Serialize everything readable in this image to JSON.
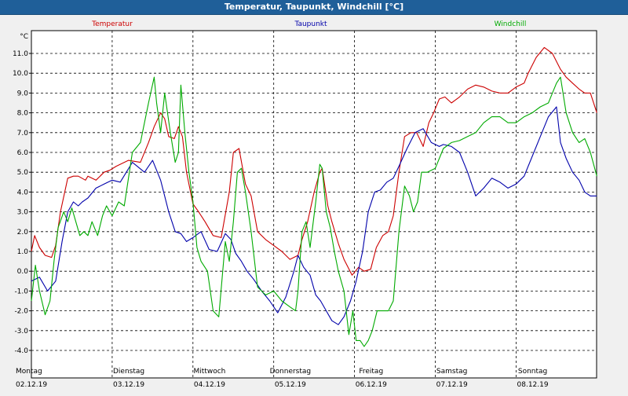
{
  "window": {
    "title": "Temperatur, Taupunkt, Windchill [°C]"
  },
  "chart_data": {
    "type": "line",
    "title": "Temperatur, Taupunkt, Windchill [°C]",
    "ylabel": "°C",
    "xlabel": "",
    "ylim": [
      -4.5,
      12.2
    ],
    "xlim": [
      0,
      7
    ],
    "y_ticks": [
      "11.0",
      "10.0",
      "9.0",
      "8.0",
      "7.0",
      "6.0",
      "5.0",
      "4.0",
      "3.0",
      "2.0",
      "1.0",
      "0.0",
      "-1.0",
      "-2.0",
      "-3.0",
      "-4.0"
    ],
    "y_tick_values": [
      11,
      10,
      9,
      8,
      7,
      6,
      5,
      4,
      3,
      2,
      1,
      0,
      -1,
      -2,
      -3,
      -4
    ],
    "x_tick_days": [
      {
        "day": "Montag",
        "date": "02.12.19"
      },
      {
        "day": "Dienstag",
        "date": "03.12.19"
      },
      {
        "day": "Mittwoch",
        "date": "04.12.19"
      },
      {
        "day": "Donnerstag",
        "date": "05.12.19"
      },
      {
        "day": "Freitag",
        "date": "06.12.19"
      },
      {
        "day": "Samstag",
        "date": "07.12.19"
      },
      {
        "day": "Sonntag",
        "date": "08.12.19"
      }
    ],
    "grid": true,
    "legend_placement": "top",
    "series": [
      {
        "name": "Temperatur",
        "color": "#cc0000",
        "x": [
          0.0,
          0.04,
          0.1,
          0.17,
          0.25,
          0.3,
          0.36,
          0.45,
          0.52,
          0.58,
          0.67,
          0.7,
          0.8,
          0.9,
          0.97,
          1.05,
          1.2,
          1.35,
          1.45,
          1.52,
          1.6,
          1.65,
          1.7,
          1.77,
          1.82,
          1.87,
          1.92,
          2.0,
          2.07,
          2.15,
          2.25,
          2.35,
          2.45,
          2.5,
          2.57,
          2.65,
          2.72,
          2.8,
          2.9,
          3.0,
          3.1,
          3.2,
          3.3,
          3.35,
          3.42,
          3.5,
          3.57,
          3.6,
          3.67,
          3.72,
          3.8,
          3.87,
          3.92,
          3.97,
          4.05,
          4.12,
          4.2,
          4.27,
          4.35,
          4.42,
          4.48,
          4.55,
          4.62,
          4.7,
          4.77,
          4.85,
          4.92,
          4.98,
          5.05,
          5.12,
          5.2,
          5.3,
          5.4,
          5.5,
          5.6,
          5.7,
          5.8,
          5.9,
          6.0,
          6.1,
          6.15,
          6.25,
          6.35,
          6.45,
          6.55,
          6.62,
          6.7,
          6.78,
          6.85,
          6.92,
          7.0
        ],
        "values": [
          1.0,
          1.8,
          1.2,
          0.8,
          0.7,
          1.3,
          3.0,
          4.7,
          4.8,
          4.8,
          4.6,
          4.8,
          4.6,
          5.0,
          5.1,
          5.3,
          5.6,
          5.5,
          6.5,
          7.3,
          8.0,
          7.7,
          6.8,
          6.7,
          7.3,
          6.8,
          5.0,
          3.4,
          3.0,
          2.5,
          1.8,
          1.7,
          4.0,
          6.0,
          6.2,
          4.4,
          3.8,
          2.0,
          1.6,
          1.3,
          1.0,
          0.6,
          0.8,
          1.6,
          2.5,
          4.0,
          5.0,
          5.2,
          3.3,
          2.5,
          1.4,
          0.6,
          0.2,
          -0.2,
          0.2,
          0.0,
          0.1,
          1.2,
          1.8,
          2.0,
          2.8,
          5.0,
          6.8,
          7.0,
          7.0,
          6.3,
          7.5,
          8.0,
          8.7,
          8.8,
          8.5,
          8.8,
          9.2,
          9.4,
          9.3,
          9.1,
          9.0,
          9.0,
          9.3,
          9.5,
          10.0,
          10.8,
          11.3,
          11.0,
          10.2,
          9.8,
          9.5,
          9.2,
          9.0,
          9.0,
          8.0
        ]
      },
      {
        "name": "Taupunkt",
        "color": "#0000aa",
        "x": [
          0.0,
          0.1,
          0.2,
          0.3,
          0.38,
          0.45,
          0.52,
          0.58,
          0.63,
          0.7,
          0.8,
          0.9,
          1.0,
          1.1,
          1.25,
          1.4,
          1.5,
          1.6,
          1.7,
          1.78,
          1.85,
          1.92,
          2.0,
          2.1,
          2.2,
          2.3,
          2.4,
          2.47,
          2.53,
          2.6,
          2.67,
          2.75,
          2.85,
          2.95,
          3.05,
          3.15,
          3.25,
          3.3,
          3.37,
          3.45,
          3.52,
          3.58,
          3.65,
          3.72,
          3.8,
          3.87,
          3.95,
          4.02,
          4.1,
          4.17,
          4.25,
          4.32,
          4.4,
          4.48,
          4.55,
          4.65,
          4.75,
          4.85,
          4.95,
          5.05,
          5.1,
          5.2,
          5.3,
          5.4,
          5.5,
          5.6,
          5.7,
          5.8,
          5.9,
          6.0,
          6.1,
          6.2,
          6.3,
          6.4,
          6.5,
          6.55,
          6.62,
          6.7,
          6.78,
          6.85,
          6.92,
          7.0
        ],
        "values": [
          -0.5,
          -0.3,
          -1.0,
          -0.5,
          1.5,
          3.0,
          3.5,
          3.3,
          3.5,
          3.7,
          4.2,
          4.4,
          4.6,
          4.5,
          5.5,
          5.0,
          5.6,
          4.6,
          3.0,
          2.0,
          1.9,
          1.5,
          1.7,
          2.0,
          1.1,
          1.0,
          1.9,
          1.6,
          0.9,
          0.5,
          0.0,
          -0.4,
          -1.0,
          -1.5,
          -2.1,
          -1.3,
          0.0,
          0.8,
          0.2,
          -0.2,
          -1.2,
          -1.5,
          -2.0,
          -2.5,
          -2.7,
          -2.3,
          -1.5,
          -0.5,
          1.0,
          3.0,
          4.0,
          4.1,
          4.5,
          4.7,
          5.3,
          6.2,
          7.0,
          7.2,
          6.5,
          6.3,
          6.4,
          6.3,
          6.0,
          5.0,
          3.8,
          4.2,
          4.7,
          4.5,
          4.2,
          4.4,
          4.8,
          5.8,
          6.8,
          7.8,
          8.3,
          6.5,
          5.7,
          5.0,
          4.6,
          4.0,
          3.8,
          3.8
        ]
      },
      {
        "name": "Windchill",
        "color": "#00aa00",
        "x": [
          0.0,
          0.05,
          0.1,
          0.17,
          0.23,
          0.28,
          0.33,
          0.4,
          0.45,
          0.5,
          0.55,
          0.6,
          0.65,
          0.7,
          0.75,
          0.82,
          0.88,
          0.93,
          1.0,
          1.08,
          1.15,
          1.25,
          1.35,
          1.45,
          1.52,
          1.55,
          1.6,
          1.65,
          1.72,
          1.78,
          1.82,
          1.85,
          1.9,
          1.95,
          2.0,
          2.05,
          2.1,
          2.18,
          2.25,
          2.32,
          2.4,
          2.45,
          2.5,
          2.55,
          2.6,
          2.65,
          2.72,
          2.8,
          2.9,
          3.0,
          3.1,
          3.2,
          3.27,
          3.3,
          3.35,
          3.4,
          3.45,
          3.52,
          3.57,
          3.6,
          3.65,
          3.7,
          3.75,
          3.8,
          3.87,
          3.93,
          3.98,
          4.02,
          4.07,
          4.12,
          4.17,
          4.22,
          4.28,
          4.35,
          4.42,
          4.48,
          4.55,
          4.62,
          4.68,
          4.73,
          4.78,
          4.83,
          4.9,
          5.0,
          5.1,
          5.2,
          5.3,
          5.4,
          5.5,
          5.6,
          5.7,
          5.8,
          5.9,
          6.0,
          6.1,
          6.2,
          6.3,
          6.4,
          6.45,
          6.5,
          6.55,
          6.62,
          6.7,
          6.78,
          6.85,
          6.92,
          7.0
        ],
        "values": [
          -1.5,
          0.3,
          -1.0,
          -2.2,
          -1.5,
          0.5,
          2.2,
          3.0,
          2.5,
          3.2,
          2.5,
          1.8,
          2.0,
          1.8,
          2.5,
          1.8,
          2.8,
          3.3,
          2.8,
          3.5,
          3.3,
          6.0,
          6.5,
          8.5,
          9.8,
          8.5,
          7.0,
          9.0,
          7.0,
          5.5,
          6.0,
          9.4,
          7.0,
          5.0,
          3.5,
          1.2,
          0.5,
          0.0,
          -2.0,
          -2.3,
          1.5,
          0.5,
          2.5,
          5.0,
          5.2,
          4.0,
          2.0,
          -0.8,
          -1.2,
          -1.0,
          -1.5,
          -1.8,
          -2.0,
          -1.0,
          2.0,
          2.5,
          1.2,
          3.5,
          5.4,
          5.2,
          3.0,
          2.2,
          1.0,
          0.0,
          -1.0,
          -3.2,
          -2.0,
          -3.5,
          -3.5,
          -3.8,
          -3.5,
          -3.0,
          -2.0,
          -2.0,
          -2.0,
          -1.5,
          2.0,
          4.3,
          3.8,
          3.0,
          3.5,
          5.0,
          5.0,
          5.2,
          6.2,
          6.5,
          6.6,
          6.8,
          7.0,
          7.5,
          7.8,
          7.8,
          7.5,
          7.5,
          7.8,
          8.0,
          8.3,
          8.5,
          9.0,
          9.5,
          9.8,
          8.0,
          7.0,
          6.5,
          6.7,
          6.0,
          4.8
        ]
      }
    ]
  }
}
